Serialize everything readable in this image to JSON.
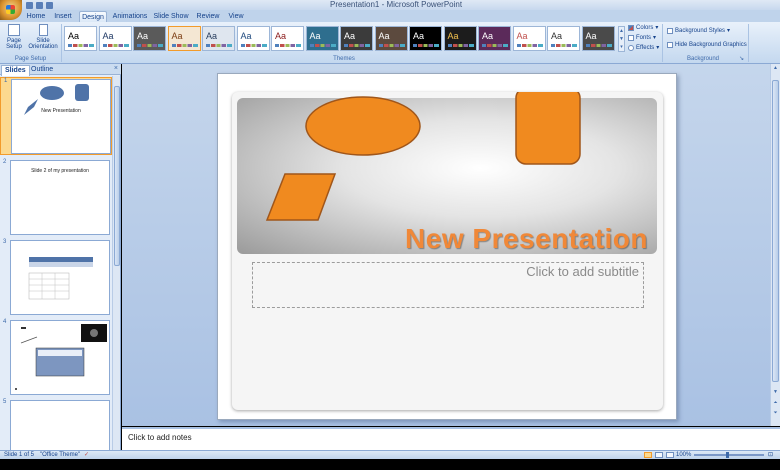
{
  "window": {
    "title": "Presentation1 - Microsoft PowerPoint"
  },
  "ribbon_tabs": [
    {
      "label": "Home"
    },
    {
      "label": "Insert"
    },
    {
      "label": "Design"
    },
    {
      "label": "Animations"
    },
    {
      "label": "Slide Show"
    },
    {
      "label": "Review"
    },
    {
      "label": "View"
    }
  ],
  "active_tab": "Design",
  "page_setup": {
    "page_setup_label": "Page Setup",
    "orientation_label": "Slide Orientation",
    "group_label": "Page Setup"
  },
  "themes": {
    "group_label": "Themes",
    "sample_text": "Aa",
    "items": [
      {
        "bg": "#ffffff",
        "fg": "#000000"
      },
      {
        "bg": "#ffffff",
        "fg": "#1f3864"
      },
      {
        "bg": "#5a5a5a",
        "fg": "#ffffff"
      },
      {
        "bg": "#f4e7d3",
        "fg": "#7a3b12"
      },
      {
        "bg": "#dfe6ef",
        "fg": "#2a3f5f"
      },
      {
        "bg": "#ffffff",
        "fg": "#1f497d"
      },
      {
        "bg": "#ffffff",
        "fg": "#8b1a1a"
      },
      {
        "bg": "#2e6e8e",
        "fg": "#ffffff"
      },
      {
        "bg": "#3b3b3b",
        "fg": "#ffffff"
      },
      {
        "bg": "#5c4a3e",
        "fg": "#ffffff"
      },
      {
        "bg": "#000000",
        "fg": "#ffffff"
      },
      {
        "bg": "#1c1c1c",
        "fg": "#f2c14e"
      },
      {
        "bg": "#5b2a5a",
        "fg": "#ffffff"
      },
      {
        "bg": "#ffffff",
        "fg": "#c0504d"
      },
      {
        "bg": "#ffffff",
        "fg": "#333333"
      },
      {
        "bg": "#4a4a4a",
        "fg": "#ffffff"
      }
    ]
  },
  "theme_options": {
    "colors": "Colors",
    "fonts": "Fonts",
    "effects": "Effects"
  },
  "background": {
    "styles": "Background Styles",
    "hide": "Hide Background Graphics",
    "group_label": "Background"
  },
  "panel": {
    "tab_slides": "Slides",
    "tab_outline": "Outline",
    "close": "×",
    "slides": [
      {
        "num": "1",
        "caption": "New Presentation"
      },
      {
        "num": "2",
        "caption": "Slide 2 of my presentation"
      },
      {
        "num": "3",
        "caption": ""
      },
      {
        "num": "4",
        "caption": ""
      },
      {
        "num": "5",
        "caption": ""
      }
    ]
  },
  "slide": {
    "title": "New Presentation",
    "subtitle_placeholder": "Click to add subtitle",
    "shape_color": "#f08a1f",
    "shape_stroke": "#a0561a"
  },
  "notes": {
    "placeholder": "Click to add notes"
  },
  "status": {
    "slide_info": "Slide 1 of 5",
    "theme": "\"Office Theme\"",
    "zoom": "100%"
  }
}
